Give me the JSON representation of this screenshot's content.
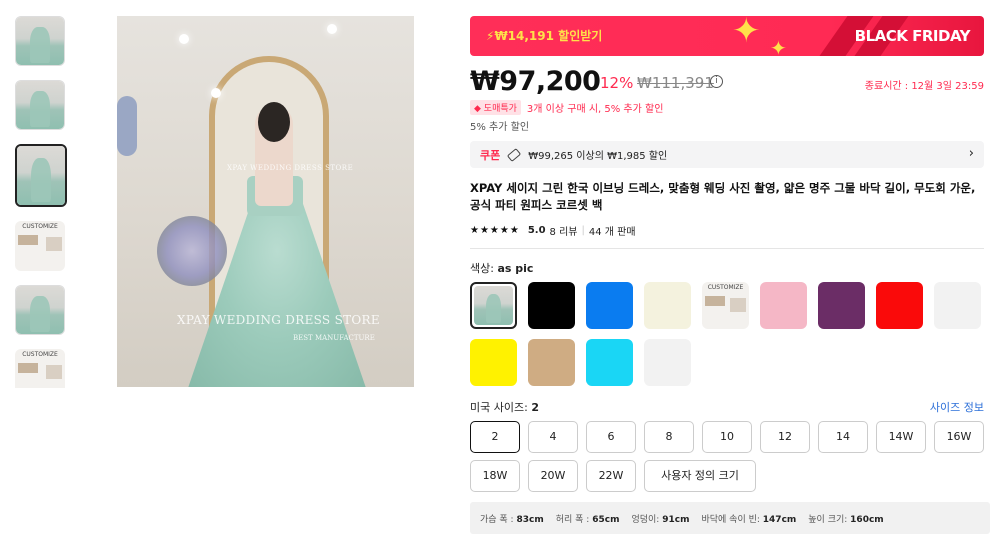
{
  "banner": {
    "coupon_text": "₩14,191 할인받기",
    "event_text": "BLACK FRIDAY"
  },
  "price": {
    "current": "₩97,200",
    "discount": "12%",
    "original": "₩111,391",
    "end_time": "종료시간 : 12월 3일 23:59"
  },
  "promo": {
    "tag": "도매특가",
    "text": "3개 이상 구매 시, 5% 추가 할인",
    "extra": "5% 추가 할인"
  },
  "coupon": {
    "label": "쿠폰",
    "text": "₩99,265 이상의 ₩1,985 할인"
  },
  "product": {
    "title": "XPAY 세이지 그린 한국 이브닝 드레스, 맞춤형 웨딩 사진 촬영, 얇은 명주 그물 바닥 길이, 무도회 가운, 공식 파티 원피스 코르셋 백",
    "rating": "5.0",
    "reviews": "8 리뷰",
    "sold": "44 개 판매"
  },
  "images": {
    "watermark_top": "XPAY WEDDING DRESS STORE",
    "watermark_main": "XPAY WEDDING DRESS STORE",
    "watermark_sub": "BEST MANUFACTURE",
    "customize_text": "CUSTOMIZE"
  },
  "color": {
    "label": "색상:",
    "selected": "as pic",
    "swatches": [
      {
        "name": "as pic",
        "type": "photo"
      },
      {
        "name": "black",
        "color": "#000000"
      },
      {
        "name": "blue",
        "color": "#0a7cf0"
      },
      {
        "name": "ivory",
        "color": "#f4f2de"
      },
      {
        "name": "customize",
        "type": "custom"
      },
      {
        "name": "pink",
        "color": "#f5b7c6"
      },
      {
        "name": "purple",
        "color": "#6b2d66"
      },
      {
        "name": "red",
        "color": "#fa0a0a"
      },
      {
        "name": "white",
        "color": "#f2f2f2"
      },
      {
        "name": "yellow",
        "color": "#fff200"
      },
      {
        "name": "champagne",
        "color": "#cfac83"
      },
      {
        "name": "sky blue",
        "color": "#1ad6f5"
      },
      {
        "name": "white2",
        "color": "#f2f2f2"
      }
    ]
  },
  "size": {
    "label": "미국 사이즈:",
    "selected": "2",
    "guide": "사이즈 정보",
    "options": [
      "2",
      "4",
      "6",
      "8",
      "10",
      "12",
      "14",
      "14W",
      "16W",
      "18W",
      "20W",
      "22W",
      "사용자 정의 크기"
    ]
  },
  "measurements": {
    "bust_label": "가슴 폭 :",
    "bust": "83cm",
    "waist_label": "허리 폭 :",
    "waist": "65cm",
    "hip_label": "엉덩이:",
    "hip": "91cm",
    "hollow_label": "바닥에 속이 빈:",
    "hollow": "147cm",
    "height_label": "높이 크기:",
    "height": "160cm"
  }
}
